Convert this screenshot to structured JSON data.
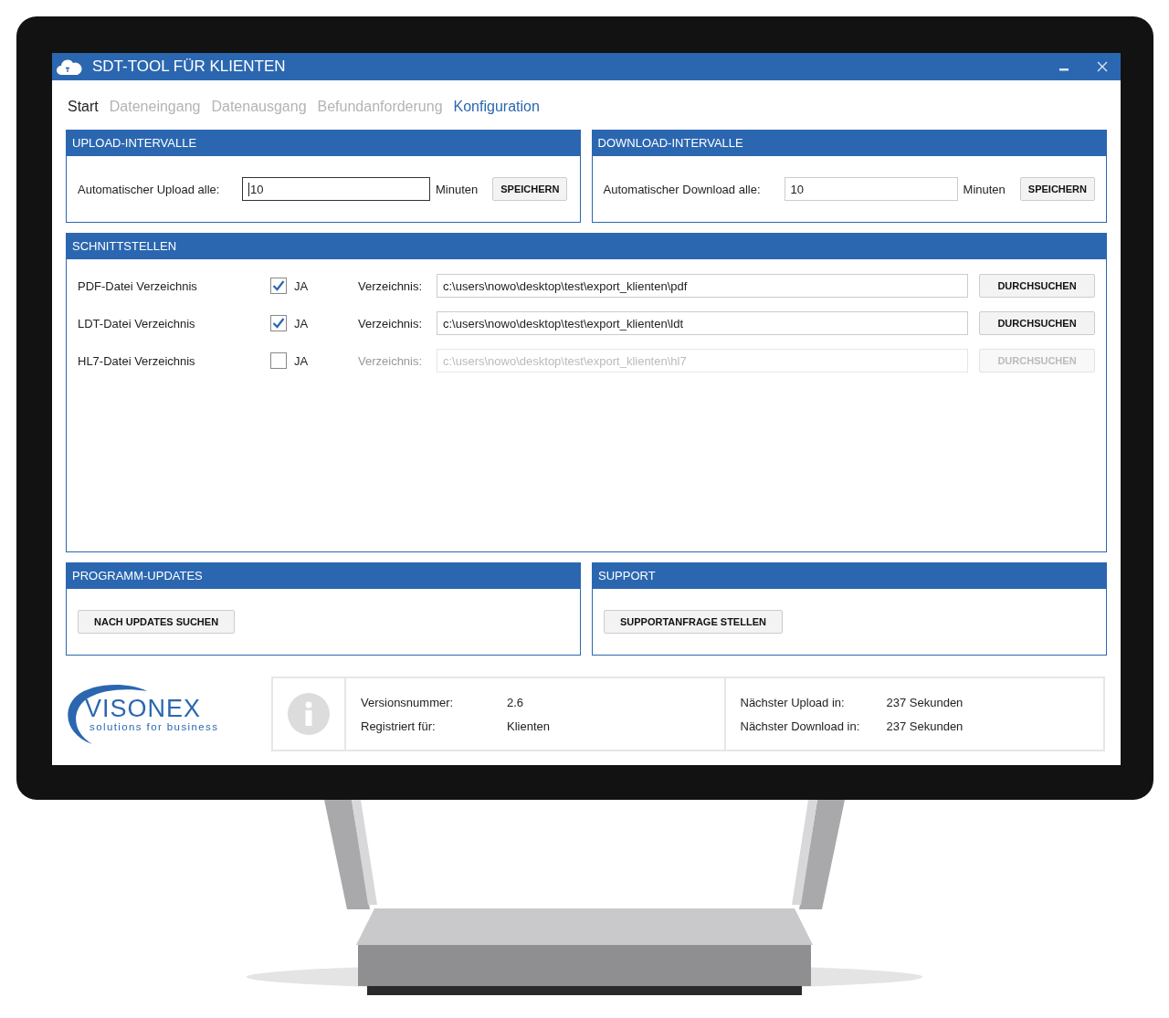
{
  "window": {
    "title": "SDT-TOOL FÜR KLIENTEN"
  },
  "tabs": [
    {
      "label": "Start",
      "selected": false,
      "disabled": false
    },
    {
      "label": "Dateneingang",
      "selected": false,
      "disabled": true
    },
    {
      "label": "Datenausgang",
      "selected": false,
      "disabled": true
    },
    {
      "label": "Befundanforderung",
      "selected": false,
      "disabled": true
    },
    {
      "label": "Konfiguration",
      "selected": true,
      "disabled": false
    }
  ],
  "intervals": [
    {
      "title": "UPLOAD-INTERVALLE",
      "label": "Automatischer Upload alle:",
      "value": "10",
      "unit": "Minuten",
      "button": "SPEICHERN",
      "focused": true
    },
    {
      "title": "DOWNLOAD-INTERVALLE",
      "label": "Automatischer Download alle:",
      "value": "10",
      "unit": "Minuten",
      "button": "SPEICHERN",
      "focused": false
    }
  ],
  "interfaces": {
    "title": "SCHNITTSTELLEN",
    "rows": [
      {
        "label": "PDF-Datei Verzeichnis",
        "checked": true,
        "check_label": "JA",
        "dir_label": "Verzeichnis:",
        "path": "c:\\users\\nowo\\desktop\\test\\export_klienten\\pdf",
        "button": "DURCHSUCHEN",
        "disabled": false
      },
      {
        "label": "LDT-Datei Verzeichnis",
        "checked": true,
        "check_label": "JA",
        "dir_label": "Verzeichnis:",
        "path": "c:\\users\\nowo\\desktop\\test\\export_klienten\\ldt",
        "button": "DURCHSUCHEN",
        "disabled": false
      },
      {
        "label": "HL7-Datei Verzeichnis",
        "checked": false,
        "check_label": "JA",
        "dir_label": "Verzeichnis:",
        "path": "c:\\users\\nowo\\desktop\\test\\export_klienten\\hl7",
        "button": "DURCHSUCHEN",
        "disabled": true
      }
    ]
  },
  "actions": [
    {
      "title": "PROGRAMM-UPDATES",
      "button": "NACH UPDATES SUCHEN"
    },
    {
      "title": "SUPPORT",
      "button": "SUPPORTANFRAGE STELLEN"
    }
  ],
  "logo": {
    "name": "VISONEX",
    "tagline": "solutions for business"
  },
  "info": [
    [
      {
        "label": "Versionsnummer:",
        "value": "2.6"
      },
      {
        "label": "Registriert für:",
        "value": "Klienten"
      }
    ],
    [
      {
        "label": "Nächster Upload in:",
        "value": "237 Sekunden"
      },
      {
        "label": "Nächster Download in:",
        "value": "237 Sekunden"
      }
    ]
  ]
}
